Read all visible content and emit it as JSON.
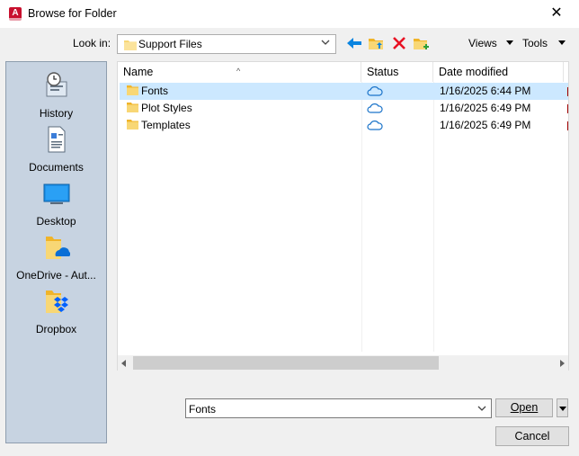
{
  "window": {
    "title": "Browse for Folder",
    "app_icon_letter": "A"
  },
  "toolbar": {
    "look_in_label": "Look in:",
    "look_in_value": "Support Files",
    "views_label": "Views",
    "tools_label": "Tools"
  },
  "places": [
    {
      "label": "History",
      "icon": "history-icon"
    },
    {
      "label": "Documents",
      "icon": "documents-icon"
    },
    {
      "label": "Desktop",
      "icon": "desktop-icon"
    },
    {
      "label": "OneDrive - Aut...",
      "icon": "onedrive-folder-icon"
    },
    {
      "label": "Dropbox",
      "icon": "dropbox-folder-icon"
    }
  ],
  "file_list": {
    "columns": [
      "Name",
      "Status",
      "Date modified"
    ],
    "rows": [
      {
        "name": "Fonts",
        "status": "cloud",
        "date": "1/16/2025 6:44 PM",
        "selected": true
      },
      {
        "name": "Plot Styles",
        "status": "cloud",
        "date": "1/16/2025 6:49 PM",
        "selected": false
      },
      {
        "name": "Templates",
        "status": "cloud",
        "date": "1/16/2025 6:49 PM",
        "selected": false
      }
    ]
  },
  "filename": {
    "value": "Fonts"
  },
  "buttons": {
    "open": "Open",
    "cancel": "Cancel"
  },
  "colors": {
    "places_bg": "#c7d3e1",
    "selection": "#cce8ff",
    "accent_blue": "#0a84e0",
    "delete_red": "#e81123",
    "app_red": "#c8102e"
  }
}
